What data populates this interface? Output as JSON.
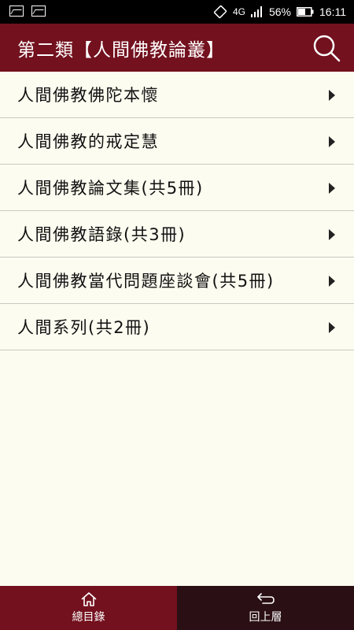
{
  "status": {
    "signal_label": "4G",
    "battery": "56%",
    "time": "16:11"
  },
  "header": {
    "title": "第二類【人間佛教論叢】"
  },
  "list": {
    "items": [
      {
        "label": "人間佛教佛陀本懷"
      },
      {
        "label": "人間佛教的戒定慧"
      },
      {
        "label": "人間佛教論文集(共5冊)"
      },
      {
        "label": "人間佛教語錄(共3冊)"
      },
      {
        "label": "人間佛教當代問題座談會(共5冊)"
      },
      {
        "label": "人間系列(共2冊)"
      }
    ]
  },
  "bottom_nav": {
    "home_label": "總目錄",
    "back_label": "回上層"
  },
  "colors": {
    "accent": "#73111e",
    "back_tab": "#2a0f14",
    "background": "#fdfcf0"
  }
}
